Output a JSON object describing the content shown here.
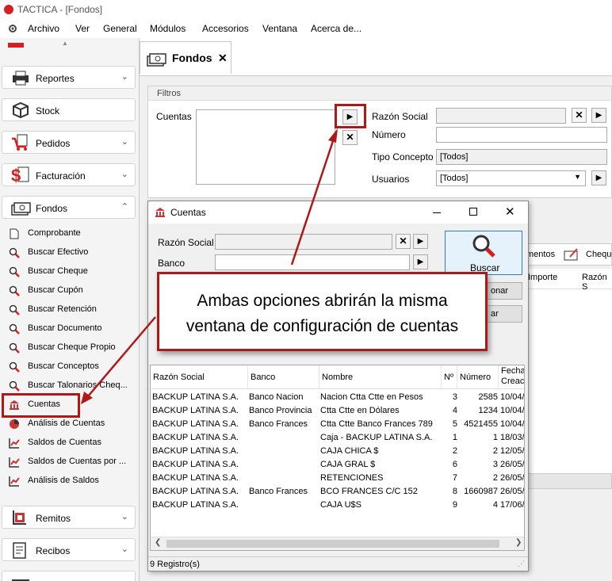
{
  "app": {
    "title": "TACTICA - [Fondos]"
  },
  "menu": [
    "Archivo",
    "Ver",
    "General",
    "Módulos",
    "Accesorios",
    "Ventana",
    "Acerca de..."
  ],
  "sidebar": {
    "groups": [
      {
        "label": "Reportes",
        "icon": "printer-icon"
      },
      {
        "label": "Stock",
        "icon": "box-icon"
      },
      {
        "label": "Pedidos",
        "icon": "cart-icon"
      },
      {
        "label": "Facturación",
        "icon": "dollar-icon"
      },
      {
        "label": "Fondos",
        "icon": "money-icon"
      }
    ],
    "items": [
      {
        "label": "Comprobante",
        "icon": "document-icon"
      },
      {
        "label": "Buscar Efectivo",
        "icon": "search-icon"
      },
      {
        "label": "Buscar Cheque",
        "icon": "search-icon"
      },
      {
        "label": "Buscar Cupón",
        "icon": "search-icon"
      },
      {
        "label": "Buscar Retención",
        "icon": "search-icon"
      },
      {
        "label": "Buscar Documento",
        "icon": "search-icon"
      },
      {
        "label": "Buscar Cheque Propio",
        "icon": "search-icon"
      },
      {
        "label": "Buscar Conceptos",
        "icon": "search-icon"
      },
      {
        "label": "Buscar Talonarios Cheq...",
        "icon": "search-icon"
      },
      {
        "label": "Cuentas",
        "icon": "bank-icon"
      },
      {
        "label": "Análisis de Cuentas",
        "icon": "pie-chart-icon"
      },
      {
        "label": "Saldos de Cuentas",
        "icon": "chart-icon"
      },
      {
        "label": "Saldos de Cuentas por ...",
        "icon": "chart-icon"
      },
      {
        "label": "Análisis de Saldos",
        "icon": "chart-icon"
      }
    ],
    "bottom_groups": [
      {
        "label": "Remitos",
        "icon": "delivery-icon"
      },
      {
        "label": "Recibos",
        "icon": "receipt-icon"
      }
    ]
  },
  "tab": {
    "label": "Fondos",
    "close": "✕"
  },
  "filtros": {
    "title": "Filtros",
    "cuentas_label": "Cuentas",
    "razon_social_label": "Razón Social",
    "razon_social_value": "",
    "numero_label": "Número",
    "numero_value": "",
    "tipo_concepto_label": "Tipo Concepto",
    "tipo_concepto_value": "[Todos]",
    "usuarios_label": "Usuarios",
    "usuarios_value": "[Todos]"
  },
  "background_tabs": {
    "movimientos": "mentos",
    "cheques": "Cheque"
  },
  "background_grid": {
    "importe": "Importe",
    "razon": "Razón S"
  },
  "dialog": {
    "title": "Cuentas",
    "razon_social_label": "Razón Social",
    "banco_label": "Banco",
    "buscar_label": "Buscar",
    "btn2_partial": "onar",
    "btn3_partial": "ar",
    "columns": [
      "Razón Social",
      "Banco",
      "Nombre",
      "Nº",
      "Número",
      "Fecha Creac"
    ],
    "rows": [
      [
        "BACKUP LATINA S.A.",
        "Banco Nacion",
        "Nacion Ctta Ctte en Pesos",
        "3",
        "2585",
        "10/04/"
      ],
      [
        "BACKUP LATINA S.A.",
        "Banco Provincia",
        "Ctta Ctte en Dólares",
        "4",
        "1234",
        "10/04/"
      ],
      [
        "BACKUP LATINA S.A.",
        "Banco Frances",
        "Ctta Ctte Banco Frances 789",
        "5",
        "4521455",
        "10/04/"
      ],
      [
        "BACKUP LATINA S.A.",
        "",
        "Caja - BACKUP LATINA S.A.",
        "1",
        "1",
        "18/03/"
      ],
      [
        "BACKUP LATINA S.A.",
        "",
        "CAJA CHICA $",
        "2",
        "2",
        "12/05/"
      ],
      [
        "BACKUP LATINA S.A.",
        "",
        "CAJA GRAL $",
        "6",
        "3",
        "26/05/"
      ],
      [
        "BACKUP LATINA S.A.",
        "",
        "RETENCIONES",
        "7",
        "2",
        "26/05/"
      ],
      [
        "BACKUP LATINA S.A.",
        "Banco Frances",
        "BCO FRANCES C/C 152",
        "8",
        "1660987",
        "26/05/"
      ],
      [
        "BACKUP LATINA S.A.",
        "",
        "CAJA U$S",
        "9",
        "4",
        "17/06/"
      ]
    ],
    "status": "9 Registro(s)"
  },
  "callout": {
    "text": "Ambas opciones abrirán la misma\nventana de configuración de cuentas"
  },
  "colors": {
    "highlight": "#b01818",
    "accent_blue": "#2c7fd6"
  }
}
